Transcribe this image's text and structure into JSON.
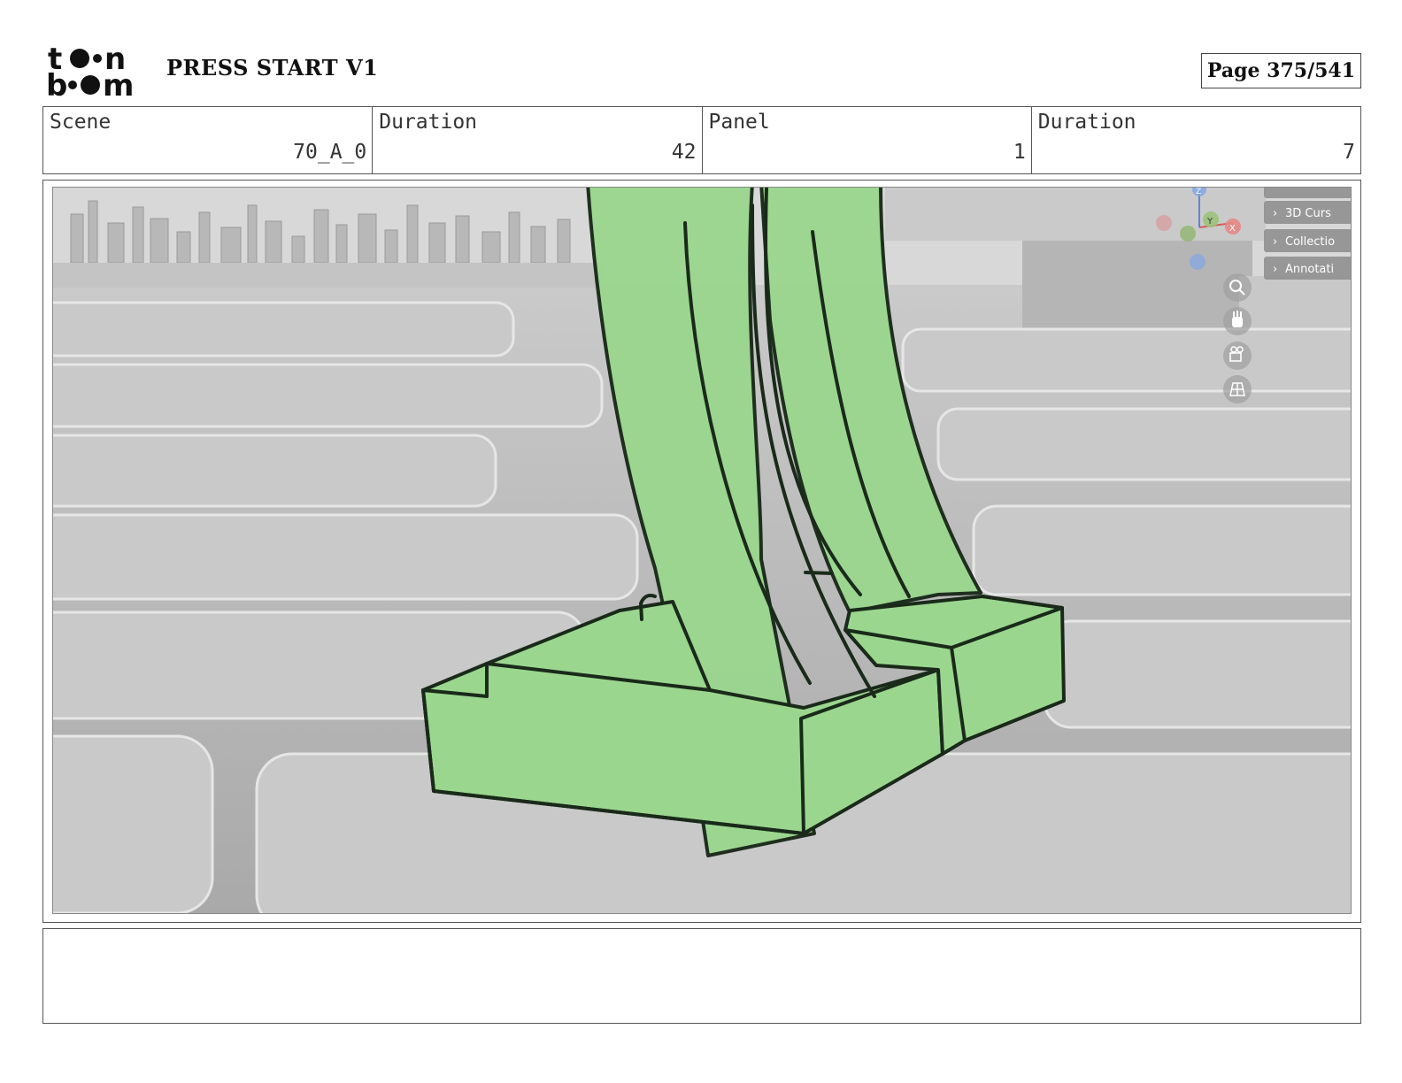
{
  "header": {
    "logo_text": "toon boom",
    "project_title": "PRESS START V1",
    "page_label": "Page 375/541"
  },
  "info": [
    {
      "label": "Scene",
      "value": "70_A_0"
    },
    {
      "label": "Duration",
      "value": "42"
    },
    {
      "label": "Panel",
      "value": "1"
    },
    {
      "label": "Duration",
      "value": "7"
    }
  ],
  "viewport_overlay": {
    "menu_items": [
      "3D Curs",
      "Collectio",
      "Annotati"
    ],
    "gizmo_axes": [
      "Z",
      "Y",
      "X"
    ],
    "tool_icons": [
      "zoom-icon",
      "hand-icon",
      "camera-icon",
      "grid-icon"
    ]
  },
  "colors": {
    "sketch_fill": "#9bd68f",
    "sketch_stroke": "#1a2a1a",
    "floor_gray": "#bdbdbd"
  },
  "notes": ""
}
